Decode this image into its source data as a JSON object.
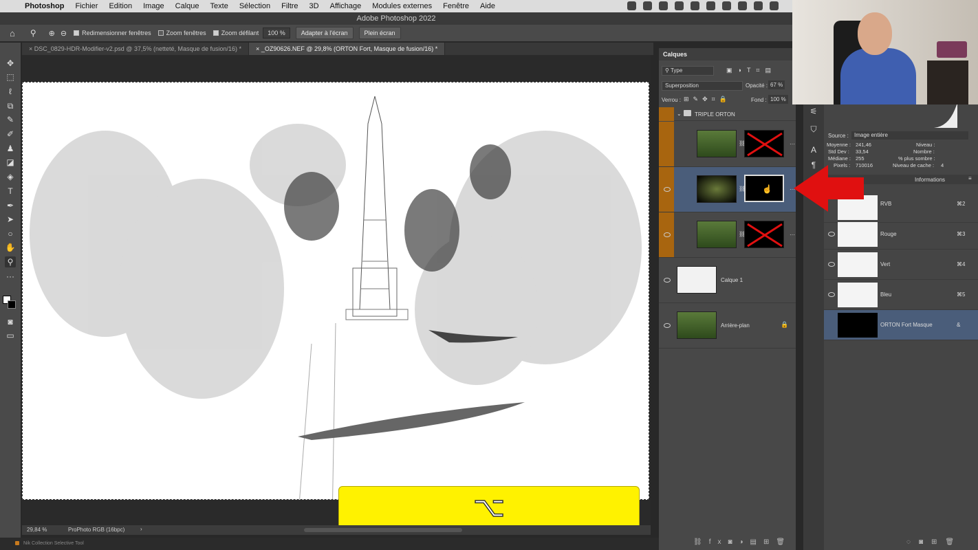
{
  "menubar": {
    "app_name": "Photoshop",
    "items": [
      "Fichier",
      "Edition",
      "Image",
      "Calque",
      "Texte",
      "Sélection",
      "Filtre",
      "3D",
      "Affichage",
      "Modules externes",
      "Fenêtre",
      "Aide"
    ]
  },
  "window_title": "Adobe Photoshop 2022",
  "options_bar": {
    "resize_windows": "Redimensionner fenêtres",
    "zoom_windows": "Zoom fenêtres",
    "scrubby_zoom": "Zoom défilant",
    "zoom_value": "100 %",
    "fit_screen": "Adapter à l'écran",
    "fill_screen": "Plein écran"
  },
  "tabs": [
    {
      "label": "DSC_0829-HDR-Modifier-v2.psd @ 37,5% (netteté, Masque de fusion/16) *"
    },
    {
      "label": "_OZ90626.NEF @ 29,8% (ORTON Fort, Masque de fusion/16) *"
    }
  ],
  "status": {
    "zoom": "29,84 %",
    "profile": "ProPhoto RGB (16bpc)"
  },
  "bottom_bar": {
    "label": "Nik Collection Selective Tool"
  },
  "layers_panel": {
    "title": "Calques",
    "filter": "Type",
    "blend_mode": "Superposition",
    "opacity_label": "Opacité :",
    "opacity_value": "67 %",
    "lock_label": "Verrou :",
    "fill_label": "Fond :",
    "fill_value": "100 %",
    "group_name": "TRIPLE ORTON",
    "layers": [
      {
        "name": "Calque 1"
      },
      {
        "name": "Arrière-plan"
      }
    ]
  },
  "histogram": {
    "source_label": "Source :",
    "source_value": "Image entière",
    "rows": [
      {
        "label": "Moyenne :",
        "value": "241,46",
        "label2": "Niveau :",
        "value2": ""
      },
      {
        "label": "Std Dev :",
        "value": "33,54",
        "label2": "Nombre :",
        "value2": ""
      },
      {
        "label": "Médiane :",
        "value": "255",
        "label2": "% plus sombre :",
        "value2": ""
      },
      {
        "label": "Pixels :",
        "value": "710016",
        "label2": "Niveau de cache :",
        "value2": "4"
      }
    ]
  },
  "channels_panel": {
    "tab_info": "Informations",
    "channels": [
      {
        "name": "RVB",
        "shortcut": "⌘2"
      },
      {
        "name": "Rouge",
        "shortcut": "⌘3"
      },
      {
        "name": "Vert",
        "shortcut": "⌘4"
      },
      {
        "name": "Bleu",
        "shortcut": "⌘5"
      },
      {
        "name": "ORTON Fort Masque",
        "shortcut": "&"
      }
    ]
  },
  "key_overlay": {
    "symbol": "⌥"
  },
  "colors": {
    "accent_orange": "#a8650f",
    "selected_row": "#4a5d7a",
    "arrow_red": "#e01010",
    "key_yellow": "#fff200"
  }
}
